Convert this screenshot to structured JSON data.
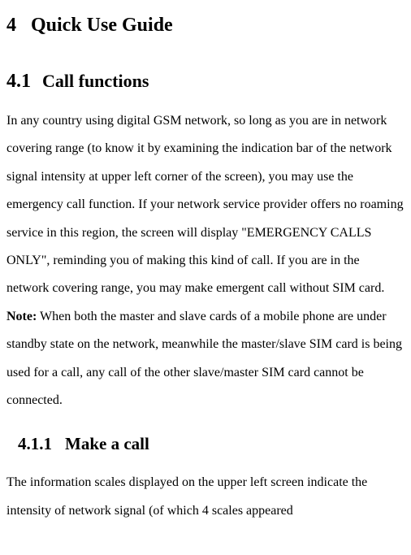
{
  "chapter": {
    "number": "4",
    "title": "Quick Use Guide"
  },
  "section": {
    "number": "4.1",
    "title": "Call functions",
    "paragraph1": "In any country using digital GSM network, so long as you are in network covering range (to know it by examining the indication bar of the network signal intensity at upper left corner of the screen), you may use the emergency call function. If your network service provider offers no roaming service in this region, the screen will display \"EMERGENCY CALLS ONLY\", reminding you of making this kind of call. If you are in the network covering range, you may make emergent call without SIM card.",
    "note_label": "Note:",
    "note_text": " When both the master and slave cards of a mobile phone are under standby state on the network, meanwhile the master/slave SIM card is being used for a call, any call of the other slave/master SIM card cannot be connected."
  },
  "subsection": {
    "number": "4.1.1",
    "title": "Make a call",
    "paragraph1": "The information scales displayed on the upper left screen indicate the intensity of network signal (of which 4 scales appeared"
  }
}
